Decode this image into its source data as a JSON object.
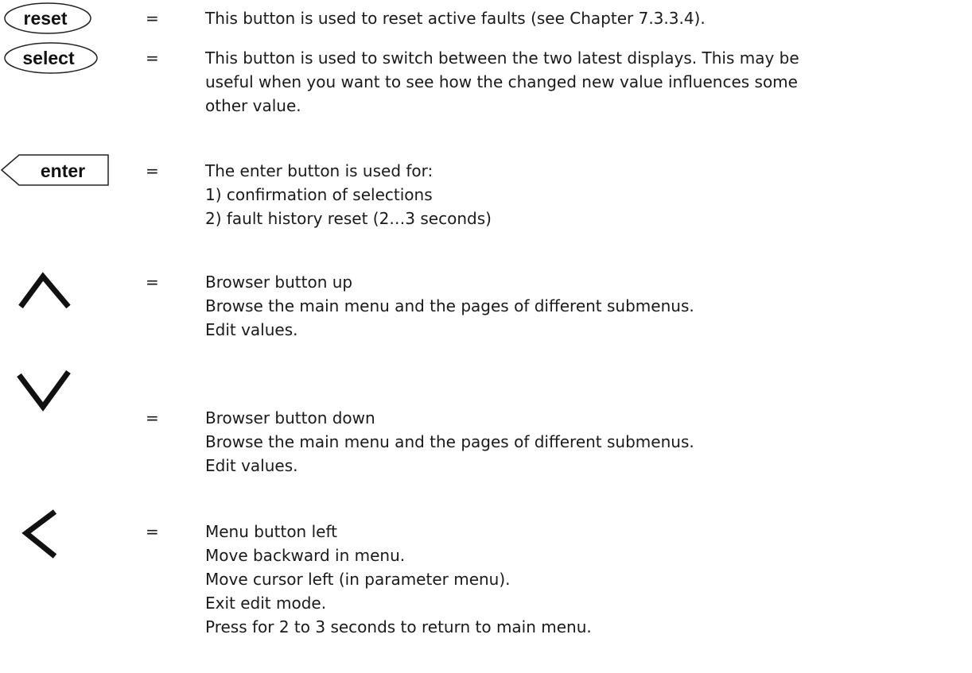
{
  "buttons": [
    {
      "key": "reset",
      "label": "reset",
      "icon": "reset-button-icon",
      "equals": "=",
      "lines": [
        "This button is used to reset active faults (see Chapter 7.3.3.4)."
      ]
    },
    {
      "key": "select",
      "label": "select",
      "icon": "select-button-icon",
      "equals": "=",
      "lines": [
        "This button is used to switch between the two latest displays. This may be",
        "useful when you want to see how the changed new value influences some",
        "other value."
      ]
    },
    {
      "key": "enter",
      "label": "enter",
      "icon": "enter-button-icon",
      "equals": "=",
      "lines": [
        "The enter button is used for:",
        "1) confirmation of selections",
        "2) fault history reset (2…3 seconds)"
      ]
    },
    {
      "key": "up",
      "icon": "chevron-up-icon",
      "equals": "=",
      "lines": [
        "Browser button up",
        "Browse the main menu and the pages of different submenus.",
        "Edit values."
      ]
    },
    {
      "key": "down",
      "icon": "chevron-down-icon",
      "equals": "=",
      "lines": [
        "Browser button down",
        "Browse the main menu and the pages of different submenus.",
        "Edit values."
      ]
    },
    {
      "key": "left",
      "icon": "chevron-left-icon",
      "equals": "=",
      "lines": [
        "Menu button left",
        "Move backward in menu.",
        "Move cursor left (in parameter menu).",
        "Exit edit mode.",
        "Press for 2 to 3 seconds to return to main menu."
      ]
    }
  ]
}
